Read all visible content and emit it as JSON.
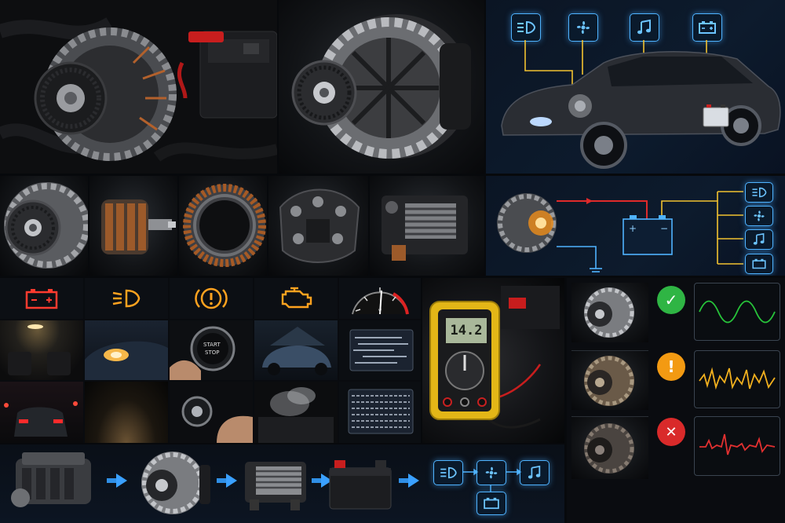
{
  "colors": {
    "background": "#07090c",
    "accent_blue": "#4fb3ff",
    "wire_yellow": "#f2c230",
    "wire_red": "#e02a2a",
    "warn_red": "#ff3b2f",
    "warn_amber": "#ffa21f",
    "status_green": "#2fb544",
    "status_amber": "#f39a12",
    "status_red": "#d92a2a"
  },
  "top_row": {
    "engine_bay": {
      "subject": "alternator in engine bay with battery"
    },
    "hero_alternator": {
      "subject": "alternator product shot"
    },
    "car_diagram": {
      "subject": "car with alternator, battery and consumers",
      "icons": [
        "headlight-icon",
        "fan-icon",
        "music-icon",
        "battery-icon"
      ]
    }
  },
  "components_row": {
    "parts": [
      "pulley",
      "rotor",
      "stator",
      "rectifier",
      "voltage-regulator"
    ],
    "circuit": {
      "icons": [
        "headlight-icon",
        "fan-icon",
        "music-icon",
        "battery-icon"
      ],
      "battery_plus": "+",
      "battery_minus": "−"
    }
  },
  "symptoms": {
    "warning_icons": [
      {
        "name": "battery-warning-icon",
        "color": "#ff3b2f"
      },
      {
        "name": "headlight-warning-icon",
        "color": "#ffa21f"
      },
      {
        "name": "brake-warning-icon",
        "color": "#ffa21f",
        "glyph": "(!)"
      },
      {
        "name": "check-engine-icon",
        "color": "#ffa21f"
      }
    ],
    "gauge": {
      "type": "voltage-gauge"
    },
    "start_button_text": [
      "START",
      "STOP"
    ]
  },
  "multimeter": {
    "reading": "14.2"
  },
  "health_status": [
    {
      "status": "ok",
      "glyph": "✓",
      "color": "#2fb544",
      "wave_color": "#27c43a"
    },
    {
      "status": "warning",
      "glyph": "!",
      "color": "#f39a12",
      "wave_color": "#f2b01e"
    },
    {
      "status": "fault",
      "glyph": "✕",
      "color": "#d92a2a",
      "wave_color": "#e23030"
    }
  ],
  "flow": {
    "steps": [
      "engine",
      "alternator",
      "voltage-regulator",
      "battery"
    ],
    "consumers": [
      "headlight-icon",
      "fan-icon",
      "music-icon",
      "battery-icon"
    ]
  }
}
